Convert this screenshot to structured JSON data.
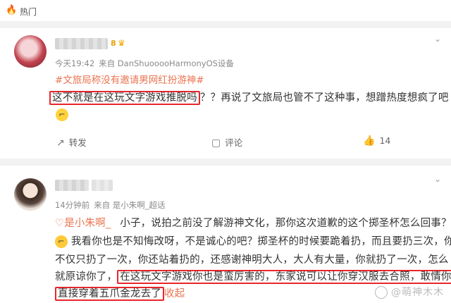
{
  "header": {
    "label": "热门",
    "icon": "fire-icon"
  },
  "post1": {
    "vip_level": "8",
    "time": "今天19:42",
    "source": "来自 DanShuooooHarmonyOS设备",
    "topic": "#文旅局称没有邀请男网红扮游神#",
    "text_highlight": "这不就是在这玩文字游戏推脱吗",
    "text_rest": "？？再说了文旅局也管不了这种事，想蹭热度想疯了吧",
    "repost_label": "转发",
    "comment_label": "评论",
    "like_count": "14"
  },
  "post2": {
    "time": "14分钟前",
    "source": "来自 是小朱啊_超话",
    "mention": "是小朱啊_",
    "line1": "小子，说拍之前没了解游神文化，那你这次道歉的这个掷圣杯怎么回事？",
    "line2": "我看你也是不知悔改呀，不是诚心的吧？掷圣杯的时候要跪着扔，而且要扔三次，你",
    "line3": "不仅只扔了一次，你还站着扔的，还感谢神明大人，大人有大量，你就扔了一次，怎么",
    "line4_a": "就原谅你了，",
    "line4_b": "在这玩文字游戏你也是蛮厉害的",
    "line4_c": "，东家说可以让你穿汉服去合照，",
    "line4_d": "敢情你",
    "line5_a": "直接穿着五爪金龙去了",
    "line5_b": "收起"
  },
  "watermark": "@萌神木木"
}
